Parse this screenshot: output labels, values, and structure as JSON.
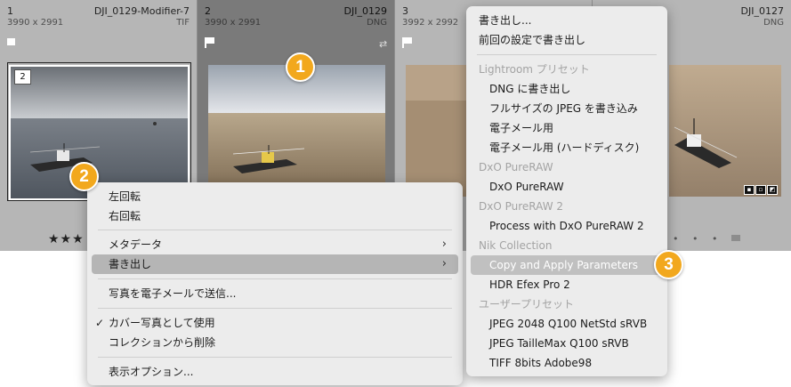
{
  "filmstrip": {
    "cells": [
      {
        "num": "1",
        "name": "DJI_0129-Modifier-7",
        "dimensions": "3990 x 2991",
        "type": "TIF",
        "stack_count": "2",
        "stars": "★★★"
      },
      {
        "num": "2",
        "name": "DJI_0129",
        "dimensions": "3990 x 2991",
        "type": "DNG"
      },
      {
        "num": "3",
        "name": "",
        "dimensions": "3992 x 2992",
        "type": ""
      },
      {
        "num": "",
        "name": "DJI_0127",
        "dimensions": "",
        "type": "DNG",
        "dots": "• • •"
      }
    ]
  },
  "left_menu": {
    "rotate_left": "左回転",
    "rotate_right": "右回転",
    "metadata": "メタデータ",
    "export": "書き出し",
    "email_photo": "写真を電子メールで送信...",
    "use_as_cover": "カバー写真として使用",
    "remove_from_collection": "コレクションから削除",
    "view_options": "表示オプション..."
  },
  "export_menu": {
    "export": "書き出し...",
    "export_previous": "前回の設定で書き出し",
    "lr_presets_header": "Lightroom プリセット",
    "lr_presets": [
      "DNG に書き出し",
      "フルサイズの JPEG を書き込み",
      "電子メール用",
      "電子メール用 (ハードディスク)"
    ],
    "dxo_header": "DxO PureRAW",
    "dxo_items": [
      "DxO PureRAW"
    ],
    "dxo2_header": "DxO PureRAW 2",
    "dxo2_items": [
      "Process with DxO PureRAW 2"
    ],
    "nik_header": "Nik Collection",
    "nik_items": [
      "Copy and Apply Parameters",
      "HDR Efex Pro 2"
    ],
    "user_presets_header": "ユーザープリセット",
    "user_presets": [
      "JPEG 2048 Q100 NetStd sRVB",
      "JPEG TailleMax Q100 sRVB",
      "TIFF 8bits Adobe98"
    ]
  },
  "callouts": [
    "1",
    "2",
    "3"
  ],
  "colors": {
    "callout": "#f2a81d",
    "menu_bg": "#ececec",
    "highlight": "#b5b5b5"
  }
}
